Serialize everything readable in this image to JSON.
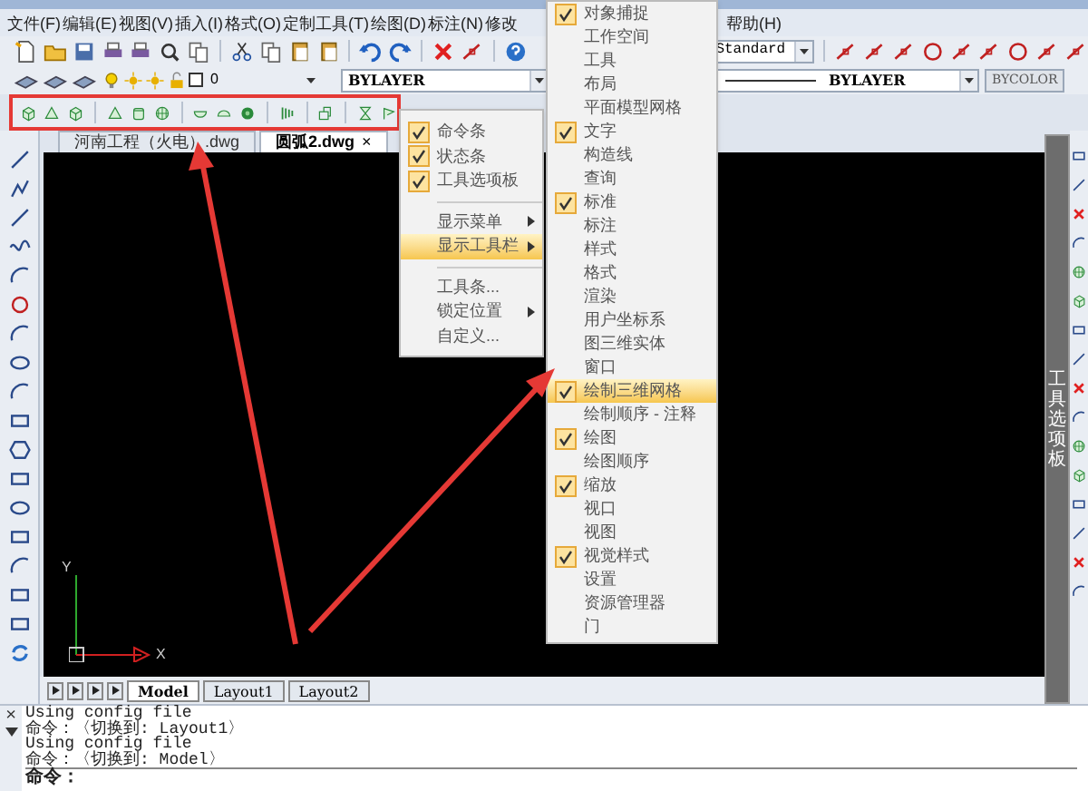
{
  "menu_bar": [
    {
      "label": "文件(F)"
    },
    {
      "label": "编辑(E)"
    },
    {
      "label": "视图(V)"
    },
    {
      "label": "插入(I)"
    },
    {
      "label": "格式(O)"
    },
    {
      "label": "定制工具(T)"
    },
    {
      "label": "绘图(D)"
    },
    {
      "label": "标注(N)"
    },
    {
      "label": "修改"
    },
    {
      "label": "帮助(H)"
    }
  ],
  "styles_toolbar": {
    "text_style": "Standard"
  },
  "properties_bar": {
    "layer": "0",
    "combo_1": "BYLAYER",
    "linetype": "BYLAYER",
    "lineweight": "BYCOLOR"
  },
  "doc_tabs": [
    {
      "label": "河南工程（火电）.dwg",
      "selected": false
    },
    {
      "label": "圆弧2.dwg",
      "selected": true,
      "close": "×"
    }
  ],
  "canvas": {
    "axis_y": "Y",
    "axis_x": "X"
  },
  "layout_tabs": [
    {
      "label": "Model",
      "selected": true
    },
    {
      "label": "Layout1",
      "selected": false
    },
    {
      "label": "Layout2",
      "selected": false
    }
  ],
  "tool_palette": {
    "title": "工具选项板"
  },
  "command_window": {
    "close": "×",
    "lines": [
      "Using config file",
      "命令：〈切换到: Layout1〉",
      "Using config file",
      "命令：〈切换到: Model〉"
    ],
    "prompt": "命令："
  },
  "context_menu": {
    "items": [
      {
        "kind": "item",
        "label": "命令条",
        "checked": true,
        "submenu": false,
        "selected": false
      },
      {
        "kind": "item",
        "label": "状态条",
        "checked": true,
        "submenu": false,
        "selected": false
      },
      {
        "kind": "item",
        "label": "工具选项板",
        "checked": true,
        "submenu": false,
        "selected": false
      },
      {
        "kind": "separator"
      },
      {
        "kind": "item",
        "label": "显示菜单",
        "checked": false,
        "submenu": true,
        "selected": false
      },
      {
        "kind": "item",
        "label": "显示工具栏",
        "checked": false,
        "submenu": true,
        "selected": true
      },
      {
        "kind": "separator"
      },
      {
        "kind": "item",
        "label": "工具条...",
        "checked": false,
        "submenu": false,
        "selected": false
      },
      {
        "kind": "item",
        "label": "锁定位置",
        "checked": false,
        "submenu": true,
        "selected": false
      },
      {
        "kind": "item",
        "label": "自定义...",
        "checked": false,
        "submenu": false,
        "selected": false
      }
    ]
  },
  "toolbars_submenu": {
    "items": [
      {
        "label": "对象捕捉",
        "checked": true,
        "selected": false
      },
      {
        "label": "工作空间",
        "checked": false,
        "selected": false
      },
      {
        "label": "工具",
        "checked": false,
        "selected": false
      },
      {
        "label": "布局",
        "checked": false,
        "selected": false
      },
      {
        "label": "平面模型网格",
        "checked": false,
        "selected": false
      },
      {
        "label": "文字",
        "checked": true,
        "selected": false
      },
      {
        "label": "构造线",
        "checked": false,
        "selected": false
      },
      {
        "label": "查询",
        "checked": false,
        "selected": false
      },
      {
        "label": "标准",
        "checked": true,
        "selected": false
      },
      {
        "label": "标注",
        "checked": false,
        "selected": false
      },
      {
        "label": "样式",
        "checked": false,
        "selected": false
      },
      {
        "label": "格式",
        "checked": false,
        "selected": false
      },
      {
        "label": "渲染",
        "checked": false,
        "selected": false
      },
      {
        "label": "用户坐标系",
        "checked": false,
        "selected": false
      },
      {
        "label": "图三维实体",
        "checked": false,
        "selected": false
      },
      {
        "label": "窗口",
        "checked": false,
        "selected": false
      },
      {
        "label": "绘制三维网格",
        "checked": true,
        "selected": true
      },
      {
        "label": "绘制顺序 - 注释",
        "checked": false,
        "selected": false
      },
      {
        "label": "绘图",
        "checked": true,
        "selected": false
      },
      {
        "label": "绘图顺序",
        "checked": false,
        "selected": false
      },
      {
        "label": "缩放",
        "checked": true,
        "selected": false
      },
      {
        "label": "视口",
        "checked": false,
        "selected": false
      },
      {
        "label": "视图",
        "checked": false,
        "selected": false
      },
      {
        "label": "视觉样式",
        "checked": true,
        "selected": false
      },
      {
        "label": "设置",
        "checked": false,
        "selected": false
      },
      {
        "label": "资源管理器",
        "checked": false,
        "selected": false
      },
      {
        "label": "门",
        "checked": false,
        "selected": false
      }
    ]
  }
}
